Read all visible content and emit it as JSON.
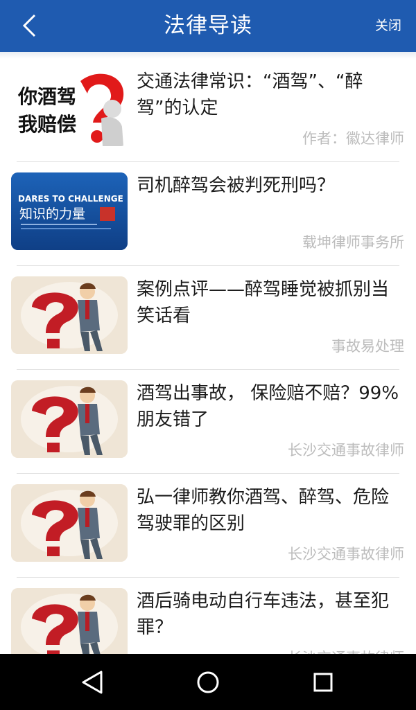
{
  "header": {
    "title": "法律导读",
    "close_label": "关闭",
    "color": "#1f5bb0"
  },
  "thumbs": {
    "drunk_line1": "你酒驾",
    "drunk_line2": "我赔偿",
    "dares_heading": "DARES TO CHALLENGE",
    "dares_main": "知识的力量"
  },
  "articles": [
    {
      "title": "交通法律常识：“酒驾”、“醉驾”的认定",
      "author": "作者：徽达律师",
      "thumb": "drunk-driving-image"
    },
    {
      "title": "司机醉驾会被判死刑吗？",
      "author": "载坤律师事务所",
      "thumb": "dares-to-challenge-image"
    },
    {
      "title": "案例点评——醉驾睡觉被抓别当笑话看",
      "author": "事故易处理",
      "thumb": "businessman-question-mark-image"
    },
    {
      "title": "酒驾出事故， 保险赔不赔？99%朋友错了",
      "author": "长沙交通事故律师",
      "thumb": "businessman-question-mark-image"
    },
    {
      "title": "弘一律师教你酒驾、醉驾、危险驾驶罪的区别",
      "author": "长沙交通事故律师",
      "thumb": "businessman-question-mark-image"
    },
    {
      "title": "酒后骑电动自行车违法，甚至犯罪？",
      "author": "长沙交通事故律师",
      "thumb": "businessman-question-mark-image"
    }
  ],
  "navbar": {
    "back_icon": "triangle-back-icon",
    "home_icon": "circle-home-icon",
    "recents_icon": "square-recents-icon"
  }
}
